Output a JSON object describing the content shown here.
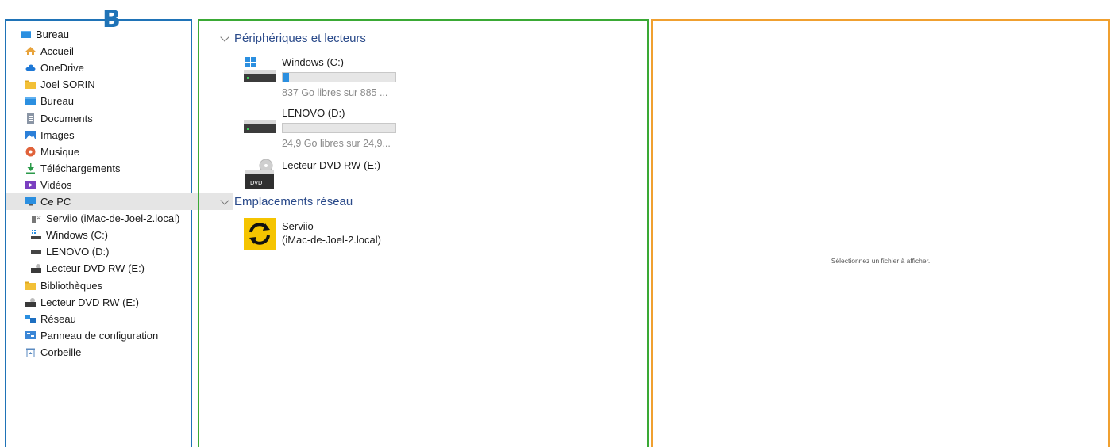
{
  "panel_label": "B",
  "nav": {
    "items": [
      {
        "label": "Bureau",
        "icon": "desktop-folder-icon",
        "indent": 0
      },
      {
        "label": "Accueil",
        "icon": "home-icon",
        "indent": 1
      },
      {
        "label": "OneDrive",
        "icon": "cloud-icon",
        "indent": 1
      },
      {
        "label": "Joel SORIN",
        "icon": "user-folder-icon",
        "indent": 1
      },
      {
        "label": "Bureau",
        "icon": "desktop-folder-icon",
        "indent": 1
      },
      {
        "label": "Documents",
        "icon": "documents-icon",
        "indent": 1
      },
      {
        "label": "Images",
        "icon": "pictures-icon",
        "indent": 1
      },
      {
        "label": "Musique",
        "icon": "music-icon",
        "indent": 1
      },
      {
        "label": "Téléchargements",
        "icon": "download-icon",
        "indent": 1
      },
      {
        "label": "Vidéos",
        "icon": "videos-icon",
        "indent": 1
      },
      {
        "label": "Ce PC",
        "icon": "this-pc-icon",
        "indent": 1,
        "selected": true
      },
      {
        "label": "Serviio (iMac-de-Joel-2.local)",
        "icon": "network-device-icon",
        "indent": 2
      },
      {
        "label": "Windows (C:)",
        "icon": "drive-c-icon",
        "indent": 2
      },
      {
        "label": "LENOVO (D:)",
        "icon": "drive-icon",
        "indent": 2
      },
      {
        "label": "Lecteur DVD RW (E:)",
        "icon": "dvd-drive-icon",
        "indent": 2
      },
      {
        "label": "Bibliothèques",
        "icon": "libraries-icon",
        "indent": 1
      },
      {
        "label": "Lecteur DVD RW (E:)",
        "icon": "dvd-drive-icon",
        "indent": 1
      },
      {
        "label": "Réseau",
        "icon": "network-icon",
        "indent": 1
      },
      {
        "label": "Panneau de configuration",
        "icon": "control-panel-icon",
        "indent": 1
      },
      {
        "label": "Corbeille",
        "icon": "recycle-bin-icon",
        "indent": 1
      }
    ]
  },
  "main": {
    "devices_header": "Périphériques et lecteurs",
    "drives": [
      {
        "name": "Windows (C:)",
        "info": "837 Go libres sur 885 ...",
        "used_fraction": 0.054,
        "icon": "windows-drive-icon"
      },
      {
        "name": "LENOVO (D:)",
        "info": "24,9 Go libres sur 24,9...",
        "used_fraction": 0.0,
        "icon": "hard-drive-icon"
      },
      {
        "name": "Lecteur DVD RW (E:)",
        "icon": "dvd-drive-icon"
      }
    ],
    "network_header": "Emplacements réseau",
    "network_items": [
      {
        "name": "Serviio",
        "detail": "(iMac-de-Joel-2.local)",
        "icon": "serviio-icon"
      }
    ]
  },
  "preview": {
    "message": "Sélectionnez un fichier à afficher."
  },
  "colors": {
    "nav_border": "#1f73b7",
    "main_border": "#3aa935",
    "preview_border": "#f0a030",
    "accent_blue": "#2b8fe0",
    "serviio_yellow": "#f5c400"
  }
}
